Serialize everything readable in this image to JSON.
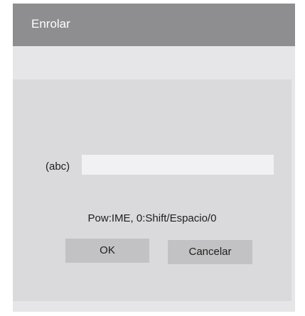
{
  "dialog": {
    "title": "Enrolar",
    "field_label": "(abc)",
    "input_value": "",
    "hint": "Pow:IME, 0:Shift/Espacio/0",
    "ok_label": "OK",
    "cancel_label": "Cancelar"
  }
}
